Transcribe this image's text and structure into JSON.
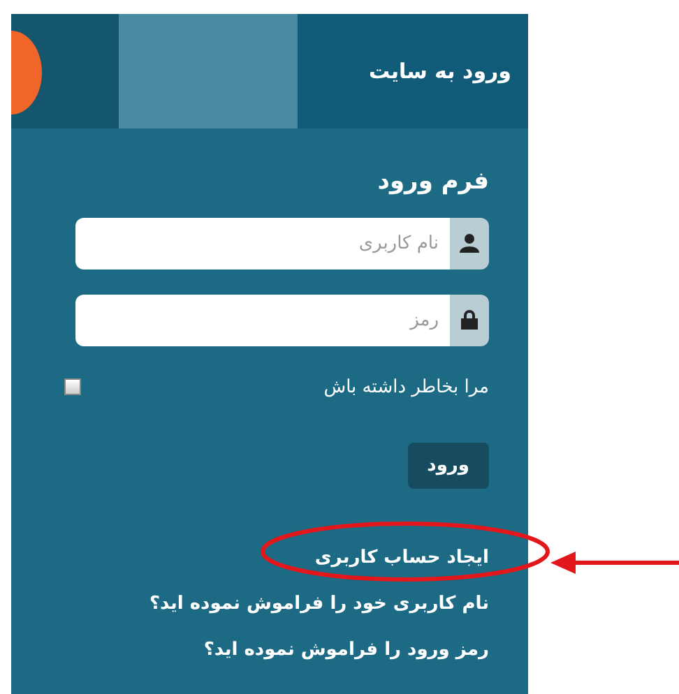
{
  "header": {
    "title": "ورود به سایت"
  },
  "form": {
    "title": "فرم ورود",
    "fields": [
      {
        "kind": "user",
        "placeholder": "نام کاربری"
      },
      {
        "kind": "lock",
        "placeholder": "رمز"
      }
    ],
    "remember": {
      "label": "مرا بخاطر داشته باش",
      "checked": false
    },
    "submit": "ورود"
  },
  "links": [
    {
      "text": "ایجاد حساب کاربری",
      "highlighted": true
    },
    {
      "text": "نام کاربری خود را فراموش نموده اید؟",
      "highlighted": false
    },
    {
      "text": "رمز ورود را فراموش نموده اید؟",
      "highlighted": false
    }
  ]
}
